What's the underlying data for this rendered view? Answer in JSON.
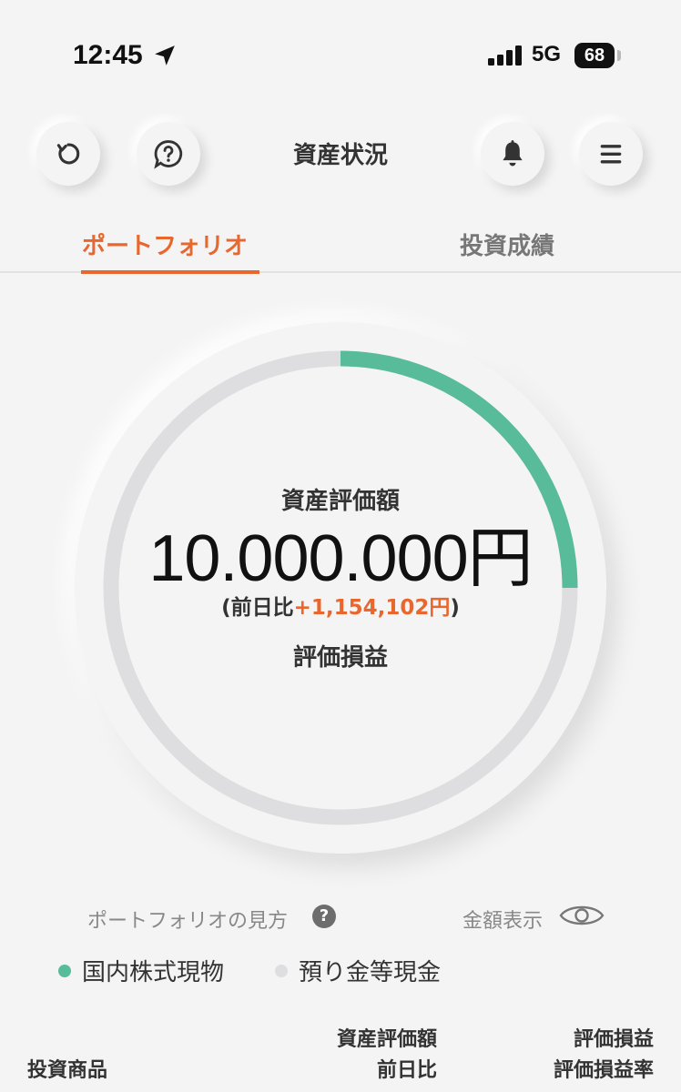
{
  "status_bar": {
    "time": "12:45",
    "network": "5G",
    "battery": "68"
  },
  "header": {
    "title": "資産状況"
  },
  "tabs": [
    {
      "label": "ポートフォリオ",
      "active": true
    },
    {
      "label": "投資成績",
      "active": false
    }
  ],
  "summary": {
    "label": "資産評価額",
    "amount": "10.000.000円",
    "change_prefix": "(前日比",
    "change_value": "+1,154,102円",
    "change_suffix": ")",
    "pl_label": "評価損益"
  },
  "allocation": [
    {
      "name": "国内株式現物",
      "fraction": 0.25,
      "color": "#58bc9a"
    },
    {
      "name": "預り金等現金",
      "fraction": 0.75,
      "color": "#dedee0"
    }
  ],
  "howto": {
    "label": "ポートフォリオの見方",
    "help_icon": "?"
  },
  "amount_toggle": {
    "label": "金額表示"
  },
  "table_header": {
    "product": "投資商品",
    "eval_amount": "資産評価額",
    "prev_day": "前日比",
    "pl": "評価損益",
    "pl_rate": "評価損益率"
  },
  "colors": {
    "accent": "#e8672e",
    "stock": "#58bc9a",
    "cash": "#dedee0"
  }
}
